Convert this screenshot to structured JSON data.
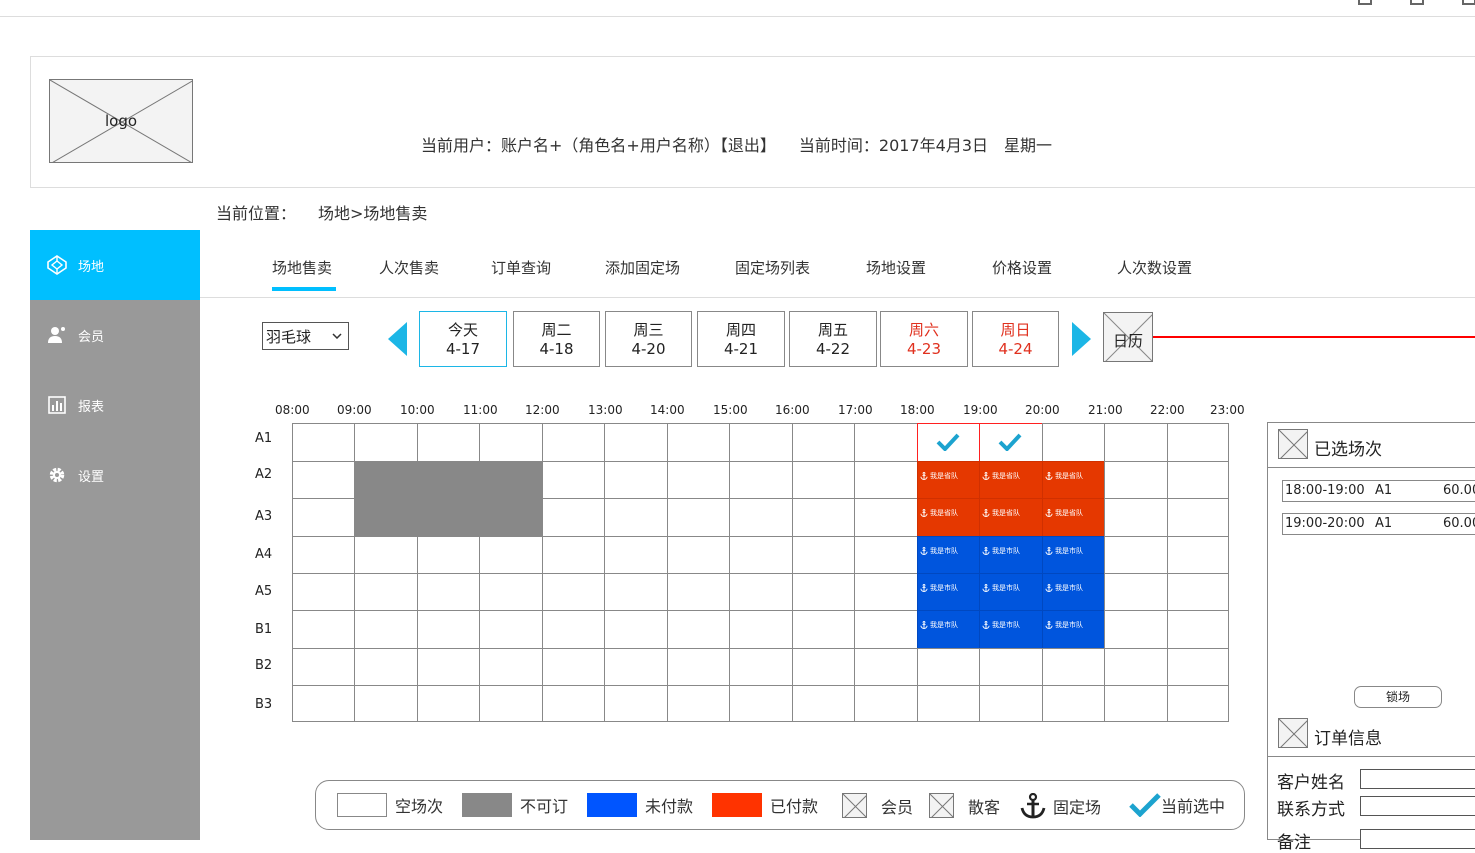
{
  "header": {
    "logo_text": "logo",
    "current_user": "当前用户：账户名+（角色名+用户名称）【退出】",
    "current_time": "当前时间：2017年4月3日　星期一"
  },
  "breadcrumb": {
    "label": "当前位置：",
    "path": "场地>场地售卖"
  },
  "sidebar": {
    "items": [
      {
        "label": "场地",
        "icon": "codepen-icon",
        "active": true
      },
      {
        "label": "会员",
        "icon": "user-add-icon"
      },
      {
        "label": "报表",
        "icon": "bar-chart-icon"
      },
      {
        "label": "设置",
        "icon": "gear-icon"
      }
    ]
  },
  "tabs": [
    "场地售卖",
    "人次售卖",
    "订单查询",
    "添加固定场",
    "固定场列表",
    "场地设置",
    "价格设置",
    "人次数设置"
  ],
  "sport_select": {
    "value": "羽毛球"
  },
  "days": [
    {
      "name": "今天",
      "date": "4-17"
    },
    {
      "name": "周二",
      "date": "4-18"
    },
    {
      "name": "周三",
      "date": "4-20"
    },
    {
      "name": "周四",
      "date": "4-21"
    },
    {
      "name": "周五",
      "date": "4-22"
    },
    {
      "name": "周六",
      "date": "4-23"
    },
    {
      "name": "周日",
      "date": "4-24"
    }
  ],
  "calendar_label": "日历",
  "times": [
    "08:00",
    "09:00",
    "10:00",
    "11:00",
    "12:00",
    "13:00",
    "14:00",
    "15:00",
    "16:00",
    "17:00",
    "18:00",
    "19:00",
    "20:00",
    "21:00",
    "22:00",
    "23:00"
  ],
  "courts": [
    "A1",
    "A2",
    "A3",
    "A4",
    "A5",
    "B1",
    "B2",
    "B3"
  ],
  "booking": {
    "paid_label": "我是省队",
    "unpaid_label": "我是市队",
    "unavailable": [
      [
        1,
        1
      ],
      [
        1,
        2
      ],
      [
        1,
        3
      ],
      [
        2,
        1
      ],
      [
        2,
        2
      ],
      [
        2,
        3
      ]
    ],
    "selected": [
      [
        0,
        10
      ],
      [
        0,
        11
      ]
    ],
    "paid": [
      [
        1,
        10
      ],
      [
        1,
        11
      ],
      [
        1,
        12
      ],
      [
        2,
        10
      ],
      [
        2,
        11
      ],
      [
        2,
        12
      ]
    ],
    "unpaid": [
      [
        3,
        10
      ],
      [
        3,
        11
      ],
      [
        3,
        12
      ],
      [
        4,
        10
      ],
      [
        4,
        11
      ],
      [
        4,
        12
      ],
      [
        5,
        10
      ],
      [
        5,
        11
      ],
      [
        5,
        12
      ]
    ]
  },
  "legend": [
    "空场次",
    "不可订",
    "未付款",
    "已付款",
    "会员",
    "散客",
    "固定场",
    "当前选中"
  ],
  "colors": {
    "accent": "#00bfff",
    "unavailable": "#888888",
    "unpaid": "#0055dd",
    "paid": "#e53800",
    "weekend": "#e0301e"
  },
  "selected_panel": {
    "title": "已选场次",
    "rows": [
      {
        "time": "18:00-19:00",
        "court": "A1",
        "price": "60.00"
      },
      {
        "time": "19:00-20:00",
        "court": "A1",
        "price": "60.00"
      }
    ],
    "lock_button": "锁场"
  },
  "order_panel": {
    "title": "订单信息",
    "fields": [
      "客户姓名",
      "联系方式",
      "备注"
    ]
  }
}
